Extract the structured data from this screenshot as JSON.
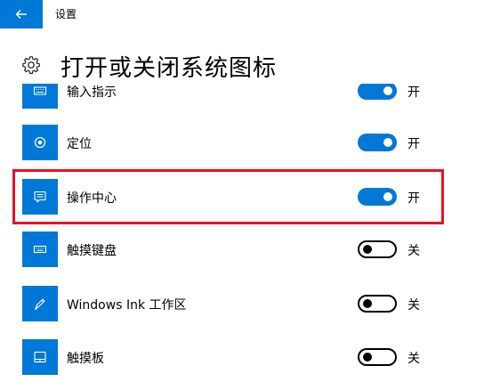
{
  "window": {
    "title": "设置"
  },
  "page": {
    "title": "打开或关闭系统图标"
  },
  "icons": {
    "back": "back-arrow-icon",
    "settings": "gear-icon"
  },
  "colors": {
    "accent": "#0078d7",
    "highlight": "#e81123"
  },
  "items": [
    {
      "label": "输入指示",
      "state": "开",
      "on": true,
      "icon": "keyboard-icon"
    },
    {
      "label": "定位",
      "state": "开",
      "on": true,
      "icon": "location-icon"
    },
    {
      "label": "操作中心",
      "state": "开",
      "on": true,
      "icon": "action-center-icon"
    },
    {
      "label": "触摸键盘",
      "state": "关",
      "on": false,
      "icon": "touch-keyboard-icon"
    },
    {
      "label": "Windows Ink 工作区",
      "state": "关",
      "on": false,
      "icon": "pen-icon"
    },
    {
      "label": "触摸板",
      "state": "关",
      "on": false,
      "icon": "touchpad-icon"
    }
  ]
}
